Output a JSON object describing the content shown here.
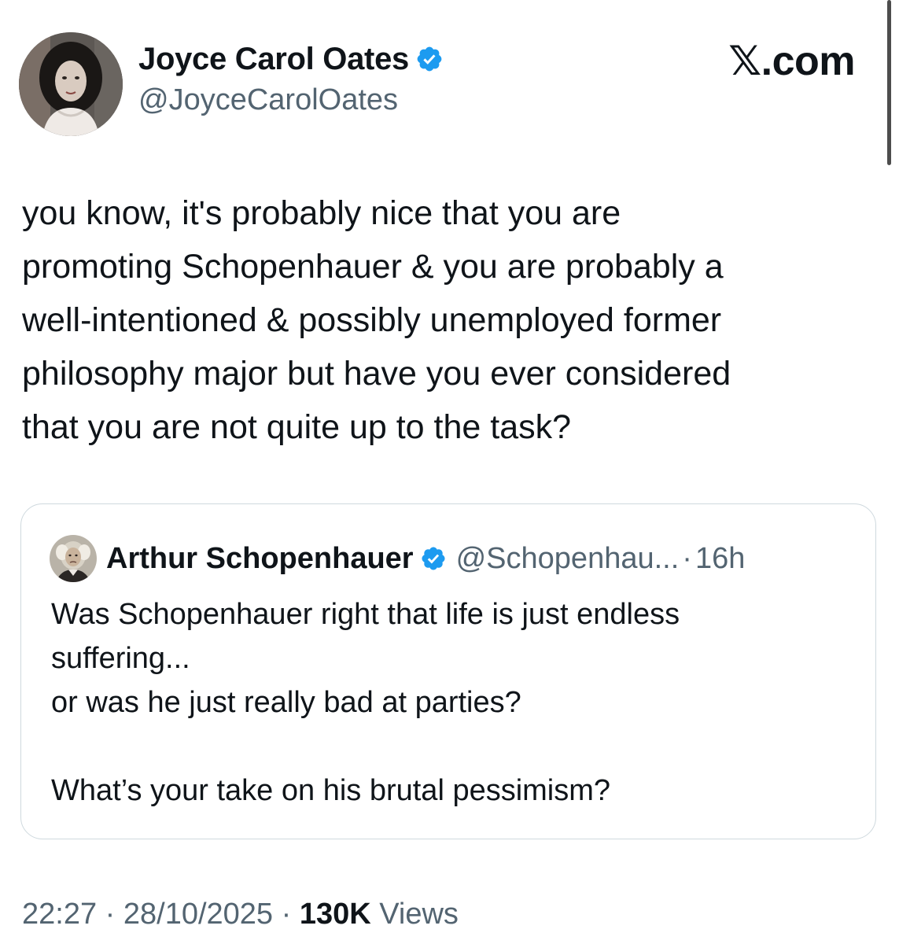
{
  "tweet": {
    "author": {
      "name": "Joyce Carol Oates",
      "handle": "@JoyceCarolOates"
    },
    "site_label": "𝕏.com",
    "text_lines": [
      "you know, it's probably nice that you are",
      "promoting Schopenhauer & you are probably a",
      "well-intentioned & possibly unemployed former",
      "philosophy major but have you ever considered",
      "that you are not quite up to the task?"
    ],
    "quoted": {
      "name": "Arthur Schopenhauer",
      "handle": "@Schopenhau...",
      "separator": "·",
      "time": "16h",
      "lines": [
        "Was Schopenhauer right that life is just endless",
        "suffering...",
        "or was he just really bad at parties?",
        "",
        "What’s your take on his brutal pessimism?"
      ]
    },
    "meta": {
      "time": "22:27",
      "separator": "·",
      "date": "28/10/2025",
      "views_count": "130K",
      "views_label": "Views"
    }
  },
  "colors": {
    "text": "#0f1419",
    "secondary": "#536471",
    "verified": "#1d9bf0",
    "border": "#cfd9de"
  },
  "icons": {
    "verified": "verified-badge-icon"
  }
}
